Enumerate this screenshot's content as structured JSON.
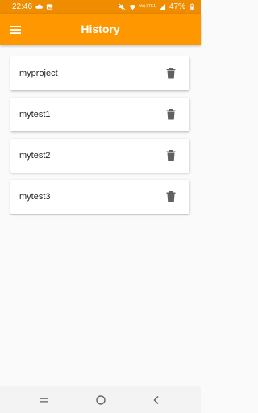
{
  "status_bar": {
    "time": "22:46",
    "battery": "47%",
    "network_label": "Vo) LTE1",
    "icons": [
      "cloud-icon",
      "image-icon",
      "mute-icon",
      "wifi-icon",
      "signal-icon",
      "battery-icon"
    ]
  },
  "app_bar": {
    "title": "History",
    "menu_icon": "hamburger-menu-icon"
  },
  "history": {
    "items": [
      {
        "label": "myproject",
        "action_icon": "trash-icon"
      },
      {
        "label": "mytest1",
        "action_icon": "trash-icon"
      },
      {
        "label": "mytest2",
        "action_icon": "trash-icon"
      },
      {
        "label": "mytest3",
        "action_icon": "trash-icon"
      }
    ]
  },
  "nav_bar": {
    "icons": [
      "recents-icon",
      "home-icon",
      "back-icon"
    ]
  },
  "colors": {
    "status_bar": "#ef8c00",
    "app_bar": "#ff9800",
    "background": "#fafafa",
    "card": "#ffffff",
    "icon_gray": "#616161"
  }
}
